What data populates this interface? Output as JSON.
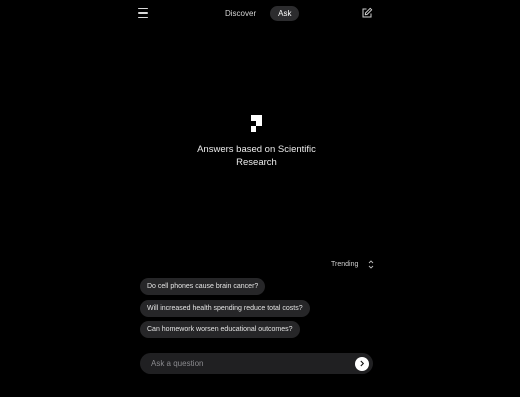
{
  "header": {
    "tabs": [
      {
        "label": "Discover",
        "active": false
      },
      {
        "label": "Ask",
        "active": true
      }
    ]
  },
  "hero": {
    "logo_icon": "consensus-logo-icon",
    "tagline": "Answers based on Scientific Research"
  },
  "trending": {
    "label": "Trending",
    "icon": "swap-vertical-icon"
  },
  "suggestions": [
    "Do cell phones cause brain cancer?",
    "Will increased health spending reduce total costs?",
    "Can homework worsen educational outcomes?"
  ],
  "ask": {
    "placeholder": "Ask a question",
    "value": "",
    "send_icon": "chevron-right-icon"
  },
  "colors": {
    "background": "#000000",
    "chip": "#262628",
    "active_tab": "#2c2c2e",
    "input": "#202022"
  }
}
